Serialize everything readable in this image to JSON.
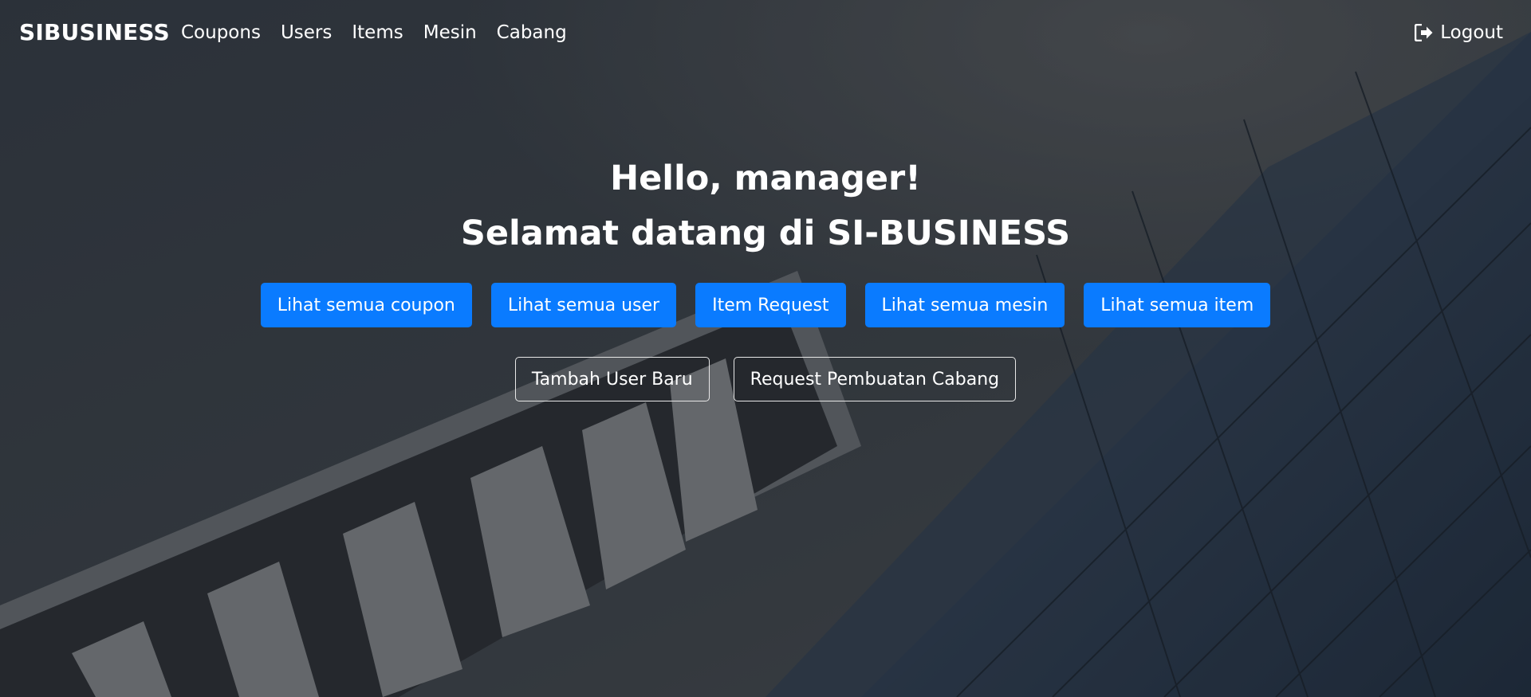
{
  "nav": {
    "brand": "SIBUSINESS",
    "links": [
      "Coupons",
      "Users",
      "Items",
      "Mesin",
      "Cabang"
    ],
    "logout_label": "Logout",
    "logout_icon": "sign-out-icon"
  },
  "hero": {
    "greeting": "Hello, manager!",
    "welcome": "Selamat datang di SI-BUSINESS"
  },
  "primary_buttons": [
    "Lihat semua coupon",
    "Lihat semua user",
    "Item Request",
    "Lihat semua mesin",
    "Lihat semua item"
  ],
  "outline_buttons": [
    "Tambah User Baru",
    "Request Pembuatan Cabang"
  ],
  "colors": {
    "primary": "#0a7bff",
    "overlay": "#2b3138",
    "text": "#ffffff"
  }
}
